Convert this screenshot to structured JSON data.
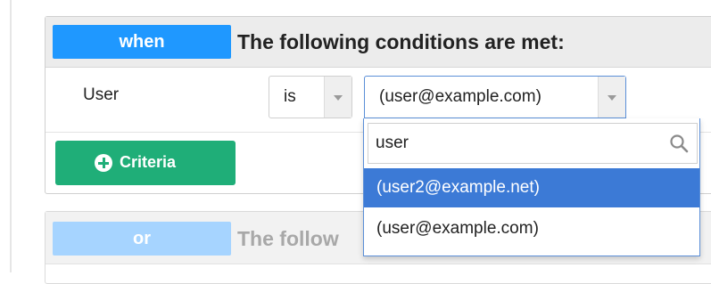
{
  "rule1": {
    "badge": "when",
    "title": "The following conditions are met:",
    "field_label": "User",
    "operator": "is",
    "value": "(user@example.com)",
    "add_button": "Criteria"
  },
  "dropdown": {
    "search_value": "user",
    "options": [
      {
        "label": "(user2@example.net)",
        "highlighted": true
      },
      {
        "label": "(user@example.com)",
        "highlighted": false
      }
    ]
  },
  "rule2": {
    "badge": "or",
    "title": "The follow"
  },
  "colors": {
    "badge_when": "#1f98ff",
    "badge_or": "#a6d4ff",
    "criteria_button": "#1fae78",
    "highlight": "#3c7ad6"
  },
  "icons": {
    "search": "search-icon",
    "add": "plus-circle-icon",
    "caret": "chevron-down-icon"
  }
}
